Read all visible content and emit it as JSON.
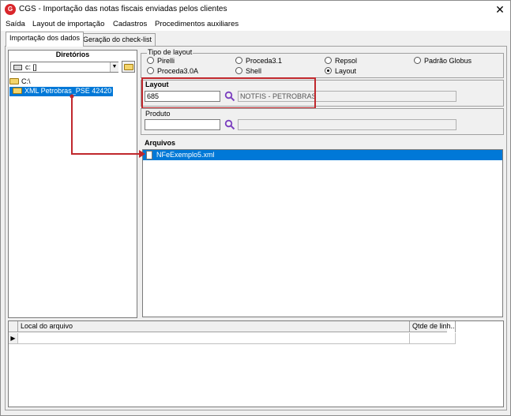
{
  "window": {
    "app_icon_text": "G",
    "title": "CGS - Importação das notas fiscais enviadas pelos clientes",
    "close_symbol": "✕"
  },
  "menu": [
    "Saída",
    "Layout de importação",
    "Cadastros",
    "Procedimentos auxiliares"
  ],
  "tabs": [
    {
      "label": "Importação dos dados",
      "active": true
    },
    {
      "label": "Geração do check-list",
      "active": false
    }
  ],
  "directories": {
    "header": "Diretórios",
    "drive_value": "c: []",
    "items": [
      {
        "label": "C:\\",
        "selected": false
      },
      {
        "label": "XML Petrobras_PSE 42420",
        "selected": true
      }
    ]
  },
  "layout_type": {
    "title": "Tipo de layout",
    "options": [
      {
        "label": "Pirelli",
        "checked": false
      },
      {
        "label": "Proceda3.1",
        "checked": false
      },
      {
        "label": "Repsol",
        "checked": false
      },
      {
        "label": "Padrão Globus",
        "checked": false
      },
      {
        "label": "Proceda3.0A",
        "checked": false
      },
      {
        "label": "Shell",
        "checked": false
      },
      {
        "label": "Layout",
        "checked": true
      }
    ]
  },
  "layout": {
    "label": "Layout",
    "code": "685",
    "description": "NOTFIS - PETROBRAS"
  },
  "produto": {
    "label": "Produto",
    "code": "",
    "description": ""
  },
  "arquivos": {
    "label": "Arquivos",
    "files": [
      {
        "name": "NFeExemplo5.xml",
        "selected": true
      }
    ]
  },
  "bottom_grid": {
    "columns": [
      "Local do arquivo",
      "Qtde de linh..."
    ],
    "row_indicator": "▶"
  },
  "colors": {
    "selection": "#0078d7",
    "highlight_box": "#c0282d",
    "search_icon": "#7b3fbf",
    "brand_red": "#d9262b"
  }
}
